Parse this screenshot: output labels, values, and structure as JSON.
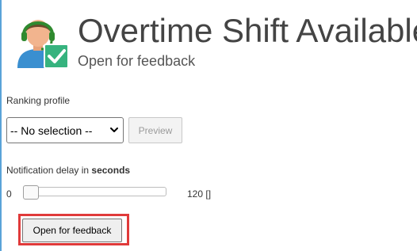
{
  "header": {
    "title": "Overtime Shift Available",
    "subtitle": "Open for feedback",
    "avatar_icon": "agent-headset-check-icon"
  },
  "ranking": {
    "label": "Ranking profile",
    "selected": "-- No selection --",
    "preview_label": "Preview"
  },
  "notification_delay": {
    "label_prefix": "Notification delay in",
    "label_unit": "seconds",
    "min": "0",
    "max_text": "120 []",
    "value_fraction": 0
  },
  "actions": {
    "open_label": "Open for feedback",
    "highlight_color": "#e03a3a"
  },
  "colors": {
    "accent_green": "#36b37e",
    "border_blue": "#5aa3d8"
  }
}
